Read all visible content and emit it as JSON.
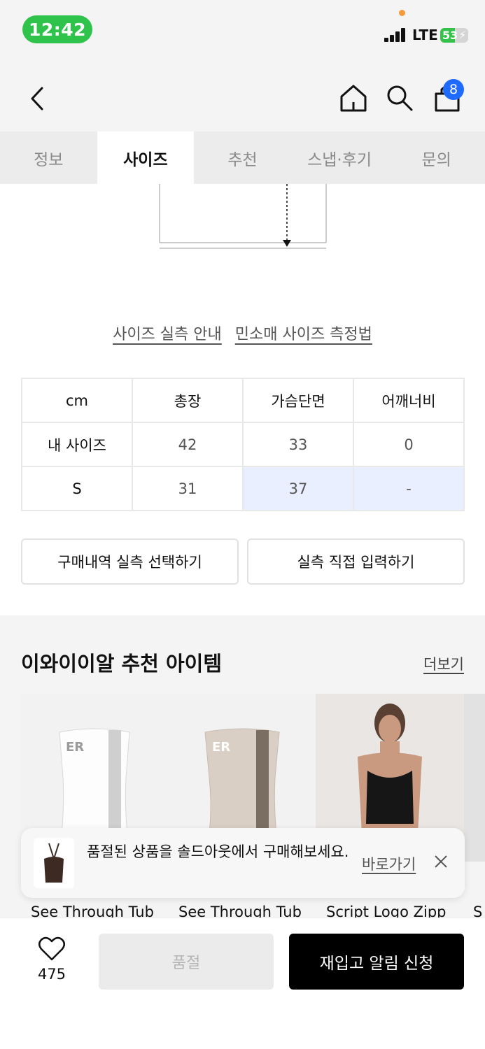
{
  "status_bar": {
    "time": "12:42",
    "network": "LTE",
    "battery": "53",
    "battery_level": 0.53
  },
  "header": {
    "cart_count": "8",
    "icons": [
      "chevron-left-icon",
      "home-icon",
      "search-icon",
      "shopping-bag-icon"
    ]
  },
  "tabs": [
    {
      "label": "정보",
      "active": false
    },
    {
      "label": "사이즈",
      "active": true
    },
    {
      "label": "추천",
      "active": false
    },
    {
      "label": "스냅·후기",
      "active": false
    },
    {
      "label": "문의",
      "active": false
    }
  ],
  "size_links": {
    "guide": "사이즈 실측 안내",
    "sleeveless": "민소매 사이즈 측정법"
  },
  "size_table": {
    "headers": [
      "cm",
      "총장",
      "가슴단면",
      "어깨너비"
    ],
    "rows": [
      {
        "label": "내 사이즈",
        "values": [
          "42",
          "33",
          "0"
        ]
      },
      {
        "label": "S",
        "values": [
          "31",
          "37",
          "-"
        ]
      }
    ]
  },
  "buttons": {
    "select_purchase": "구매내역 실측 선택하기",
    "enter_direct": "실측 직접 입력하기"
  },
  "recommend": {
    "title": "이와이이알 추천 아이템",
    "more": "더보기",
    "products": [
      {
        "name": "See Through Tub",
        "color": "#ffffff"
      },
      {
        "name": "See Through Tub",
        "color": "#d8cfc6"
      },
      {
        "name": "Script Logo Zipp",
        "color": "#1a1a1a"
      },
      {
        "name": "S",
        "color": "#e8e8e8"
      }
    ]
  },
  "toast": {
    "message": "품절된 상품을 솔드아웃에서 구매해보세요.",
    "link": "바로가기"
  },
  "bottom_bar": {
    "likes": "475",
    "soldout": "품절",
    "restock": "재입고 알림 신청"
  },
  "colors": {
    "accent_blue": "#1f6bff",
    "highlight": "#e9efff",
    "status_green": "#2fc34c"
  }
}
